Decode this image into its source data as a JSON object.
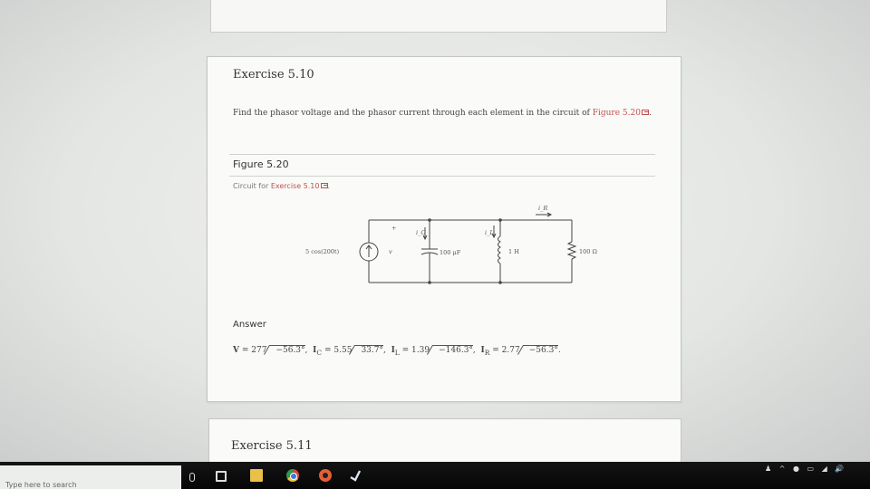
{
  "exercise": {
    "title": "Exercise 5.10",
    "task_text": "Find the phasor voltage and the phasor current through each element in the circuit of",
    "task_ref": "Figure 5.20",
    "figure_label": "Figure 5.20",
    "caption_prefix": "Circuit for",
    "caption_ref": "Exercise 5.10",
    "answer_label": "Answer"
  },
  "circuit": {
    "source_label": "5 cos(200t)",
    "v_label": "v",
    "plus_label": "+",
    "ic_label": "i_C",
    "il_label": "i_L",
    "ir_label": "i_R",
    "cap_label": "100 μF",
    "ind_label": "1 H",
    "res_label": "100 Ω"
  },
  "answer": {
    "v_sym": "V",
    "v_mag": "= 277",
    "v_ang": "−56.3°",
    "ic_sym": "I",
    "ic_sub": "C",
    "ic_mag": "= 5.55",
    "ic_ang": "33.7°",
    "il_sym": "I",
    "il_sub": "L",
    "il_mag": "= 1.39",
    "il_ang": "−146.3°",
    "ir_sym": "I",
    "ir_sub": "R",
    "ir_mag": "= 2.77",
    "ir_ang": "−56.3°"
  },
  "next_exercise": {
    "title": "Exercise 5.11"
  },
  "taskbar": {
    "search_placeholder": "Type here to search"
  }
}
